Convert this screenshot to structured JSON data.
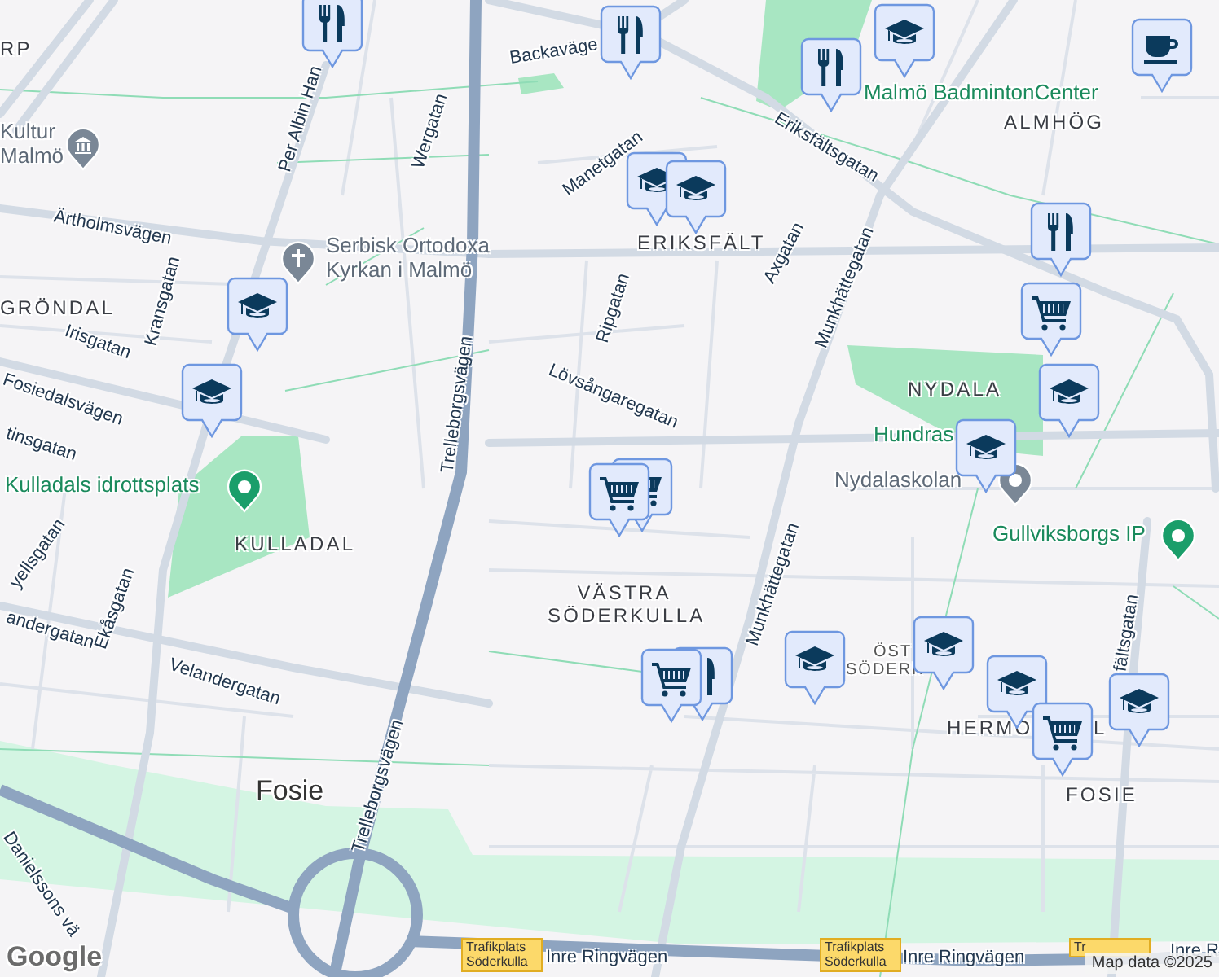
{
  "map": {
    "labels": [
      {
        "text": "RP",
        "kind": "district"
      },
      {
        "text": "Backaväge",
        "kind": "street"
      },
      {
        "text": "Per Albin Han",
        "kind": "street"
      },
      {
        "text": "Kultur Malmö",
        "kind": "landmark"
      },
      {
        "text": "Wergatan",
        "kind": "street"
      },
      {
        "text": "Manetgatan",
        "kind": "street"
      },
      {
        "text": "Malmö BadmintonCenter",
        "kind": "park"
      },
      {
        "text": "ALMHÖG",
        "kind": "district"
      },
      {
        "text": "Eriksfältsgatan",
        "kind": "street"
      },
      {
        "text": "Ärtholmsvägen",
        "kind": "street"
      },
      {
        "text": "Serbisk Ortodoxa Kyrkan i Malmö",
        "kind": "landmark"
      },
      {
        "text": "ERIKSFÄLT",
        "kind": "district"
      },
      {
        "text": "Axgatan",
        "kind": "street"
      },
      {
        "text": "Munkhättegatan",
        "kind": "street"
      },
      {
        "text": "GRÖNDAL",
        "kind": "district"
      },
      {
        "text": "Kransgatan",
        "kind": "street"
      },
      {
        "text": "Ripgatan",
        "kind": "street"
      },
      {
        "text": "Irisgatan",
        "kind": "street"
      },
      {
        "text": "Trelleborgsvägen",
        "kind": "street"
      },
      {
        "text": "Fosiedalsvägen",
        "kind": "street"
      },
      {
        "text": "Lövsångaregatan",
        "kind": "street"
      },
      {
        "text": "NYDALA",
        "kind": "district"
      },
      {
        "text": "tinsgatan",
        "kind": "street"
      },
      {
        "text": "Hundras",
        "kind": "park"
      },
      {
        "text": "Nydalaskolan",
        "kind": "landmark"
      },
      {
        "text": "Kulladals idrottsplats",
        "kind": "park"
      },
      {
        "text": "KULLADAL",
        "kind": "district"
      },
      {
        "text": "Gullviksborgs IP",
        "kind": "park"
      },
      {
        "text": "yellsgatan",
        "kind": "street"
      },
      {
        "text": "VÄSTRA SÖDERKULLA",
        "kind": "district"
      },
      {
        "text": "Ekåsgatan",
        "kind": "street"
      },
      {
        "text": "andergatan",
        "kind": "street"
      },
      {
        "text": "Velandergatan",
        "kind": "street"
      },
      {
        "text": "Munkhättegatan",
        "kind": "street"
      },
      {
        "text": "ÖST",
        "kind": "small-district"
      },
      {
        "text": "SÖDERK",
        "kind": "small-district"
      },
      {
        "text": "HERMO",
        "kind": "district"
      },
      {
        "text": "L",
        "kind": "district"
      },
      {
        "text": "fältsgatan",
        "kind": "street"
      },
      {
        "text": "Trelleborgsvägen",
        "kind": "street"
      },
      {
        "text": "Fosie",
        "kind": "place"
      },
      {
        "text": "FOSIE",
        "kind": "district"
      },
      {
        "text": "Danielssons vä",
        "kind": "street"
      },
      {
        "text": "Trafikplats Söderkulla",
        "kind": "road-sign"
      },
      {
        "text": "Inre Ringvägen",
        "kind": "street"
      },
      {
        "text": "Trafikplats Söderkulla",
        "kind": "road-sign"
      },
      {
        "text": "Inre Ringvägen",
        "kind": "street"
      },
      {
        "text": "Tr",
        "kind": "road-sign"
      },
      {
        "text": "Inre R",
        "kind": "street"
      }
    ],
    "markers": [
      {
        "kind": "restaurant"
      },
      {
        "kind": "restaurant"
      },
      {
        "kind": "school"
      },
      {
        "kind": "restaurant"
      },
      {
        "kind": "cafe"
      },
      {
        "kind": "school"
      },
      {
        "kind": "school"
      },
      {
        "kind": "restaurant"
      },
      {
        "kind": "shop"
      },
      {
        "kind": "school"
      },
      {
        "kind": "school"
      },
      {
        "kind": "school"
      },
      {
        "kind": "school"
      },
      {
        "kind": "shop"
      },
      {
        "kind": "shop"
      },
      {
        "kind": "restaurant"
      },
      {
        "kind": "shop"
      },
      {
        "kind": "school"
      },
      {
        "kind": "school"
      },
      {
        "kind": "school"
      },
      {
        "kind": "shop"
      },
      {
        "kind": "school"
      }
    ],
    "attribution": "Map data ©2025",
    "logo": "Google"
  }
}
